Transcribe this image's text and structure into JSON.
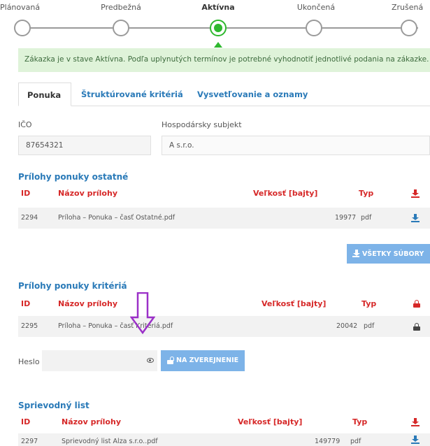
{
  "stepper": {
    "steps": [
      {
        "label": "Plánovaná",
        "active": false
      },
      {
        "label": "Predbežná",
        "active": false
      },
      {
        "label": "Aktívna",
        "active": true
      },
      {
        "label": "Ukončená",
        "active": false
      },
      {
        "label": "Zrušená",
        "active": false
      }
    ]
  },
  "status_message": "Zákazka je v stave Aktívna. Podľa uplynutých termínov je potrebné vyhodnotiť jednotlivé podania na zákazke.",
  "tabs": [
    {
      "label": "Ponuka",
      "active": true
    },
    {
      "label": "Štruktúrované kritériá",
      "active": false
    },
    {
      "label": "Vysvetľovanie a oznamy",
      "active": false
    }
  ],
  "fields": {
    "ico_label": "IČO",
    "ico_value": "87654321",
    "subject_label": "Hospodársky subjekt",
    "subject_value": "A    s.r.o."
  },
  "columns": {
    "id": "ID",
    "name": "Názov prílohy",
    "size": "Veľkosť [bajty]",
    "type": "Typ"
  },
  "sections": {
    "other": {
      "title": "Prílohy ponuky ostatné",
      "rows": [
        {
          "id": "2294",
          "name": "Príloha – Ponuka – časť Ostatné.pdf",
          "size": "19977",
          "type": "pdf"
        }
      ],
      "download_all_label": "VŠETKY SÚBORY"
    },
    "criteria": {
      "title": "Prílohy ponuky kritériá",
      "rows": [
        {
          "id": "2295",
          "name": "Príloha – Ponuka – časť Kritériá.pdf",
          "size": "20042",
          "type": "pdf"
        }
      ],
      "password_label": "Heslo",
      "publish_label": "NA ZVEREJNENIE"
    },
    "cover": {
      "title": "Sprievodný list",
      "rows": [
        {
          "id": "2297",
          "name": "Sprievodný list Alza s.r.o..pdf",
          "size": "149779",
          "type": "pdf"
        }
      ]
    }
  },
  "colors": {
    "accent_blue": "#2a7ab8",
    "header_red": "#d62828",
    "active_green": "#2eb82e",
    "annotation_purple": "#9b30c8"
  }
}
